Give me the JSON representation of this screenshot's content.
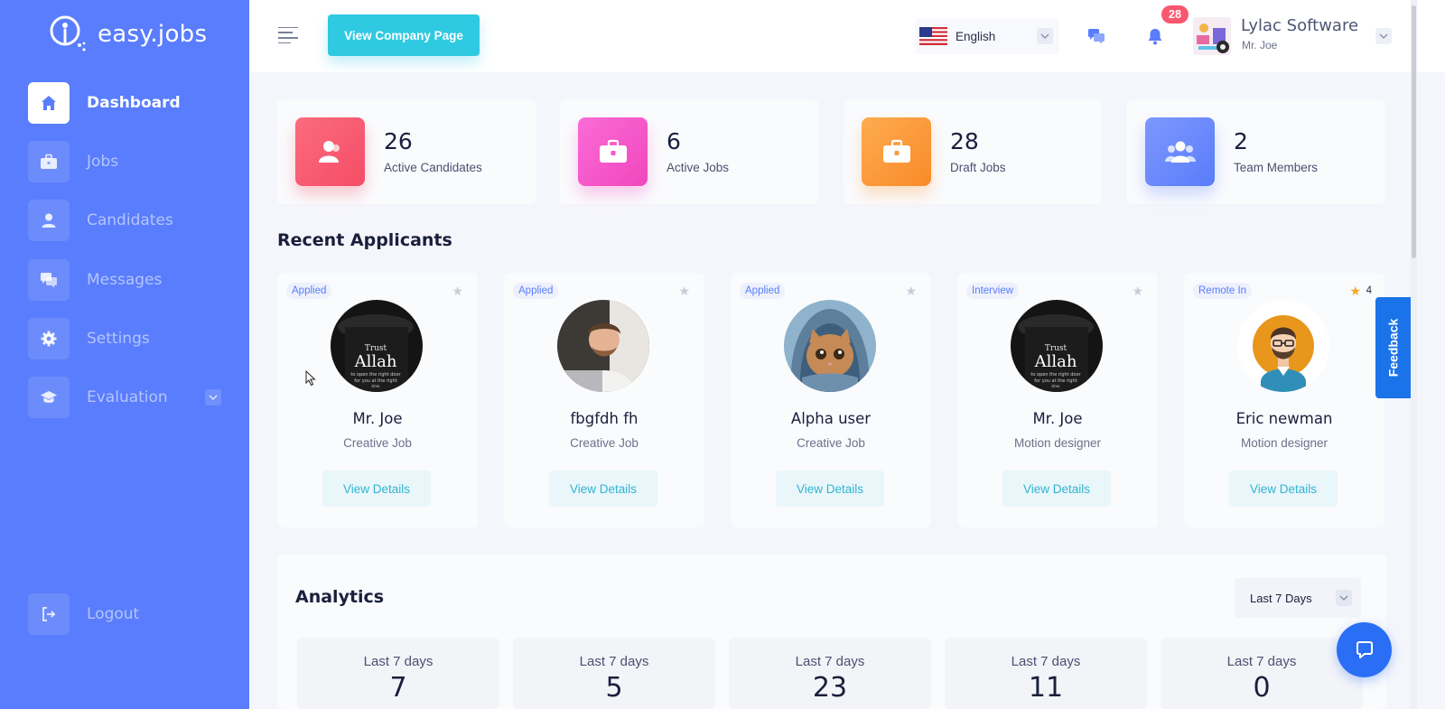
{
  "brand": {
    "name": "easy.jobs"
  },
  "sidebar": {
    "items": [
      {
        "label": "Dashboard",
        "icon": "home-icon",
        "active": true
      },
      {
        "label": "Jobs",
        "icon": "briefcase-icon",
        "active": false
      },
      {
        "label": "Candidates",
        "icon": "user-icon",
        "active": false
      },
      {
        "label": "Messages",
        "icon": "chat-icon",
        "active": false
      },
      {
        "label": "Settings",
        "icon": "gear-icon",
        "active": false
      },
      {
        "label": "Evaluation",
        "icon": "graduation-cap-icon",
        "active": false,
        "has_dropdown": true
      }
    ],
    "logout_label": "Logout"
  },
  "header": {
    "company_page_button": "View Company Page",
    "language": "English",
    "notification_count": "28",
    "company_name": "Lylac Software",
    "user_name": "Mr. Joe"
  },
  "stats": [
    {
      "value": "26",
      "label": "Active Candidates",
      "icon": "users-icon",
      "color": "#f8576d"
    },
    {
      "value": "6",
      "label": "Active Jobs",
      "icon": "briefcase-icon",
      "color": "#f656c8"
    },
    {
      "value": "28",
      "label": "Draft Jobs",
      "icon": "briefcase-icon",
      "color": "#fb9c3a"
    },
    {
      "value": "2",
      "label": "Team Members",
      "icon": "team-icon",
      "color": "#6b8afc"
    }
  ],
  "recent_applicants": {
    "title": "Recent Applicants",
    "items": [
      {
        "status": "Applied",
        "name": "Mr. Joe",
        "job": "Creative Job",
        "button": "View Details",
        "starred": false,
        "rating": ""
      },
      {
        "status": "Applied",
        "name": "fbgfdh fh",
        "job": "Creative Job",
        "button": "View Details",
        "starred": false,
        "rating": ""
      },
      {
        "status": "Applied",
        "name": "Alpha user",
        "job": "Creative Job",
        "button": "View Details",
        "starred": false,
        "rating": ""
      },
      {
        "status": "Interview",
        "name": "Mr. Joe",
        "job": "Motion designer",
        "button": "View Details",
        "starred": false,
        "rating": ""
      },
      {
        "status": "Remote In",
        "name": "Eric newman",
        "job": "Motion designer",
        "button": "View Details",
        "starred": true,
        "rating": "4"
      }
    ],
    "mug_text": {
      "line1": "Trust",
      "line2": "Allah",
      "line3": "to open the right door",
      "line4": "for you at the right",
      "line5": "time"
    }
  },
  "analytics": {
    "title": "Analytics",
    "range": "Last 7 Days",
    "metrics": [
      {
        "label": "Last 7 days",
        "value": "7"
      },
      {
        "label": "Last 7 days",
        "value": "5"
      },
      {
        "label": "Last 7 days",
        "value": "23"
      },
      {
        "label": "Last 7 days",
        "value": "11"
      },
      {
        "label": "Last 7 days",
        "value": "0"
      }
    ]
  },
  "feedback_label": "Feedback",
  "colors": {
    "sidebar": "#597dfc",
    "accent_cyan": "#30c9e2",
    "badge": "#f8576d",
    "chat": "#2a6ef5"
  }
}
